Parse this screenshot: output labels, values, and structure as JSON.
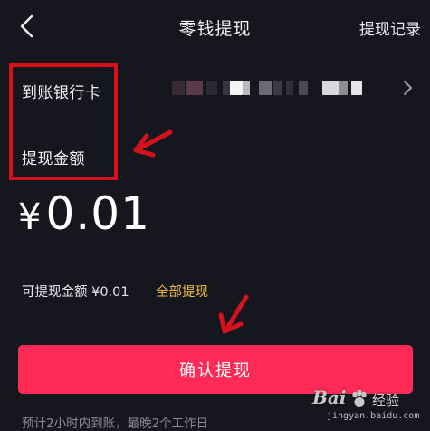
{
  "header": {
    "title": "零钱提现",
    "history_link": "提现记录",
    "back_icon": "chevron-left-icon"
  },
  "bank_row": {
    "label": "到账银行卡",
    "value_masked": true,
    "chevron_icon": "chevron-right-icon"
  },
  "amount_row": {
    "label": "提现金额",
    "currency_symbol": "¥",
    "value": "0.01"
  },
  "available": {
    "text": "可提现金额 ¥0.01",
    "withdraw_all": "全部提现"
  },
  "confirm_button": {
    "label": "确认提现"
  },
  "footnote": "预计2小时内到账，最晚2个工作日",
  "watermark": {
    "brand": "Bai",
    "product": "经验",
    "url": "jingyan.baidu.com"
  },
  "colors": {
    "background": "#15161e",
    "accent": "#ff2a55",
    "link": "#e6b93e",
    "annotation": "#d4121c"
  }
}
